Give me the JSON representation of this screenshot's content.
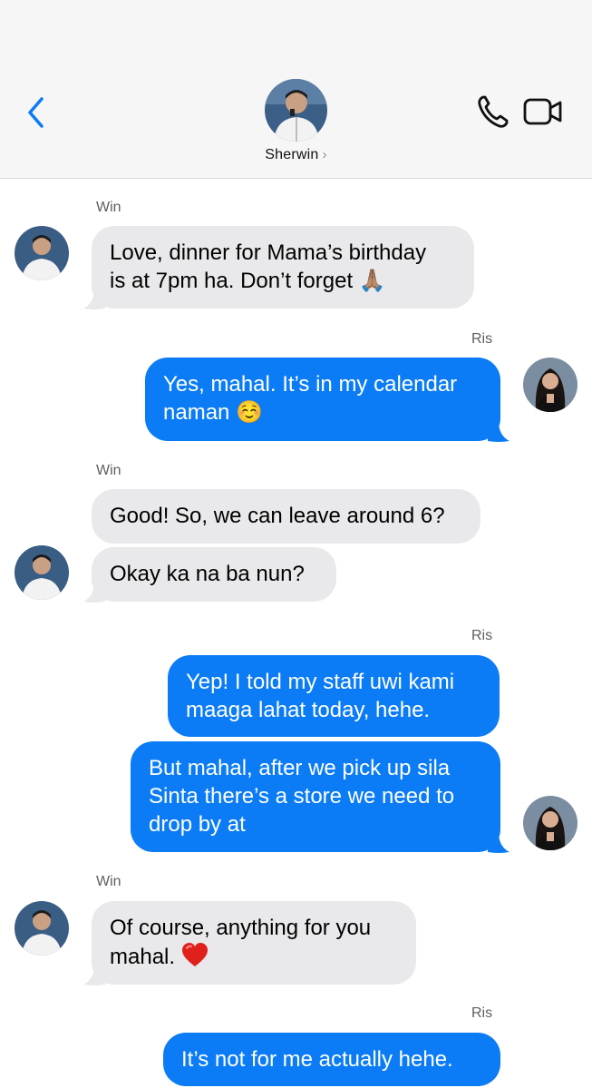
{
  "header": {
    "contact_name": "Sherwin",
    "chevron": "›",
    "icons": [
      "chevron-left-icon",
      "phone-icon",
      "video-camera-icon"
    ],
    "accent_color": "#0b7cf5"
  },
  "colors": {
    "outgoing_bubble": "#0b7cf5",
    "incoming_bubble": "#e9e9eb",
    "header_bg": "#f6f6f6"
  },
  "messages": [
    {
      "sender": "Win",
      "direction": "incoming",
      "lines": [
        "Love, dinner for Mama’s birthday",
        "is at 7pm ha. Don’t forget 🙏🏽"
      ]
    },
    {
      "sender": "Ris",
      "direction": "outgoing",
      "lines": [
        "Yes, mahal. It’s in my calendar",
        "naman ☺️"
      ]
    },
    {
      "sender": "Win",
      "direction": "incoming",
      "lines": [
        "Good! So, we can leave around 6?"
      ]
    },
    {
      "sender": "",
      "direction": "incoming",
      "lines": [
        "Okay ka na ba nun?"
      ]
    },
    {
      "sender": "Ris",
      "direction": "outgoing",
      "lines": [
        "Yep! I told my staff uwi kami",
        "maaga lahat today, hehe."
      ]
    },
    {
      "sender": "",
      "direction": "outgoing",
      "lines": [
        "But mahal, after we pick up sila",
        "Sinta there’s a store we need to",
        "drop by at"
      ]
    },
    {
      "sender": "Win",
      "direction": "incoming",
      "lines": [
        "Of course, anything for you",
        "mahal."
      ]
    },
    {
      "sender": "Ris",
      "direction": "outgoing",
      "lines": [
        "It’s not for me actually hehe."
      ]
    }
  ]
}
